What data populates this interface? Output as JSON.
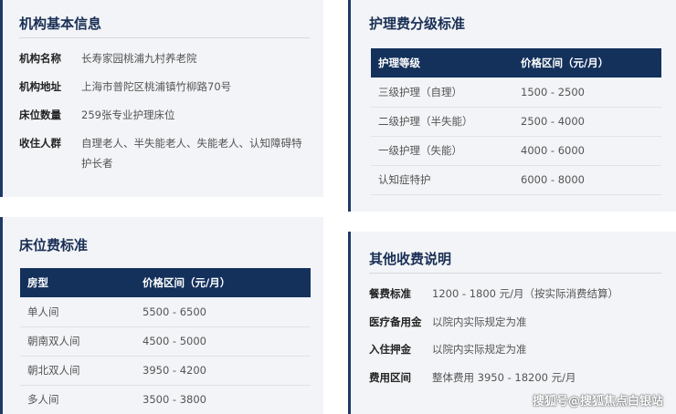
{
  "info_card": {
    "title": "机构基本信息",
    "rows": [
      {
        "label": "机构名称",
        "value": "长寿家园桃浦九村养老院"
      },
      {
        "label": "机构地址",
        "value": "上海市普陀区桃浦镇竹柳路70号"
      },
      {
        "label": "床位数量",
        "value": "259张专业护理床位"
      },
      {
        "label": "收住人群",
        "value": "自理老人、半失能老人、失能老人、认知障碍特护长者"
      }
    ]
  },
  "care_card": {
    "title": "护理费分级标准",
    "headers": [
      "护理等级",
      "价格区间（元/月）"
    ],
    "rows": [
      [
        "三级护理（自理）",
        "1500 - 2500"
      ],
      [
        "二级护理（半失能）",
        "2500 - 4000"
      ],
      [
        "一级护理（失能）",
        "4000 - 6000"
      ],
      [
        "认知症特护",
        "6000 - 8000"
      ]
    ]
  },
  "bed_card": {
    "title": "床位费标准",
    "headers": [
      "房型",
      "价格区间（元/月）"
    ],
    "rows": [
      [
        "单人间",
        "5500 - 6500"
      ],
      [
        "朝南双人间",
        "4500 - 5000"
      ],
      [
        "朝北双人间",
        "3950 - 4200"
      ],
      [
        "多人间",
        "3500 - 3800"
      ]
    ]
  },
  "other_card": {
    "title": "其他收费说明",
    "rows": [
      {
        "label": "餐费标准",
        "value": "1200 - 1800 元/月（按实际消费结算）"
      },
      {
        "label": "医疗备用金",
        "value": "以院内实际规定为准"
      },
      {
        "label": "入住押金",
        "value": "以院内实际规定为准"
      },
      {
        "label": "费用区间",
        "value": "整体费用 3950 - 18200 元/月"
      }
    ]
  },
  "watermark": "搜狐号@搜狐焦点白银站",
  "colors": {
    "accent": "#1d3a66",
    "header_bg": "#14315c",
    "card_bg": "#f2f4f7"
  }
}
